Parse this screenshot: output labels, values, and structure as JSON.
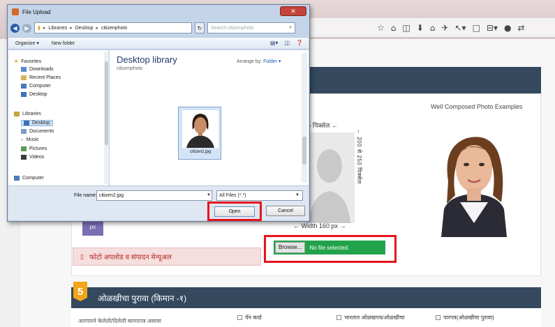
{
  "browser": {
    "toolbar_icons": [
      "star-icon",
      "bookmarks-icon",
      "pocket-icon",
      "download-icon",
      "home-icon",
      "send-icon",
      "tools-icon",
      "screenshot-icon",
      "menu-icon"
    ],
    "toolbar_glyphs": [
      "☆",
      "⌂",
      "◫",
      "⬇",
      "⌂",
      "✈",
      "↖▾",
      "□",
      "⊟▾",
      "●",
      "⇄"
    ]
  },
  "dialog": {
    "title": "File Upload",
    "path": [
      "Libraries",
      "Desktop",
      "citizenphoto"
    ],
    "search_placeholder": "Search citizenphoto",
    "organize_label": "Organize ▾",
    "new_folder_label": "New folder",
    "nav": {
      "favorites": "Favorites",
      "downloads": "Downloads",
      "recent_places": "Recent Places",
      "computer": "Computer",
      "desktop": "Desktop",
      "libraries": "Libraries",
      "lib_desktop": "Desktop",
      "documents": "Documents",
      "music": "Music",
      "pictures": "Pictures",
      "videos": "Videos",
      "computer2": "Computer"
    },
    "library_title": "Desktop library",
    "library_subtitle": "citizenphoto",
    "arrange_by_label": "Arrange by:",
    "arrange_by_value": "Folder ▾",
    "file": {
      "name": "citizen2.jpg"
    },
    "file_name_label": "File name:",
    "file_name_value": "citizen2.jpg",
    "filter_value": "All Files (*.*)",
    "open_label": "Open",
    "cancel_label": "Cancel"
  },
  "page": {
    "examples_title": "Well Composed Photo Examples",
    "dim_top": "१० पिक्सेल ←",
    "dim_height": "← 200 से 250 पिक्सेल",
    "dim_width": "← Width 160 px →",
    "purple_box_text": "px",
    "browse_label": "Browse...",
    "browse_status": "No file selected.",
    "error_text": "फोटो अपलोड व संपादन मेन्यूअल",
    "section5_number": "5",
    "section5_title": "ओळखीचा पुरावा (किमान -१)",
    "proof_note": "आरपारने केलेली/दिलेली कागदपत्र असावा",
    "options": [
      "पॅन कार्ड",
      "भारतात ओळखपत्र/ओळखीचा",
      "पारपत्र(ओळखीचा पुरावा)"
    ]
  },
  "colors": {
    "section_header": "#34495e",
    "highlight_red": "#e5131d",
    "browse_green": "#22a34a",
    "error_bg": "#f5dede",
    "step_badge": "#f2a51a"
  }
}
